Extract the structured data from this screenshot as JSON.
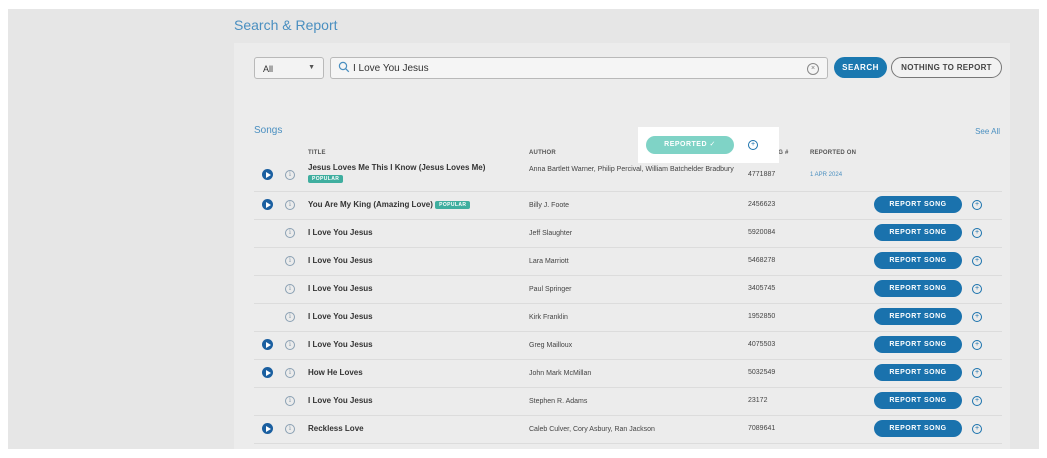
{
  "page": {
    "title": "Search & Report"
  },
  "search": {
    "filter": "All",
    "query": "I Love You Jesus",
    "search_label": "SEARCH",
    "nothing_label": "NOTHING TO REPORT"
  },
  "songs": {
    "section_title": "Songs",
    "see_all": "See All",
    "columns": {
      "title": "TITLE",
      "author": "AUTHOR",
      "ccli": "CCLI SONG #",
      "reported_on": "REPORTED ON"
    },
    "popular_label": "POPULAR",
    "report_label": "REPORT SONG",
    "reported_label": "REPORTED ✓",
    "rows": [
      {
        "title": "Jesus Loves Me This I Know (Jesus Loves Me)",
        "author": "Anna Bartlett Warner, Philip Percival, William Batchelder Bradbury",
        "ccli": "4771887",
        "reported_on": "1 APR 2024"
      },
      {
        "title": "You Are My King (Amazing Love)",
        "author": "Billy J. Foote",
        "ccli": "2456623"
      },
      {
        "title": "I Love You Jesus",
        "author": "Jeff Slaughter",
        "ccli": "5920084"
      },
      {
        "title": "I Love You Jesus",
        "author": "Lara Marriott",
        "ccli": "5468278"
      },
      {
        "title": "I Love You Jesus",
        "author": "Paul Springer",
        "ccli": "3405745"
      },
      {
        "title": "I Love You Jesus",
        "author": "Kirk Franklin",
        "ccli": "1952850"
      },
      {
        "title": "I Love You Jesus",
        "author": "Greg Mailloux",
        "ccli": "4075503"
      },
      {
        "title": "How He Loves",
        "author": "John Mark McMillan",
        "ccli": "5032549"
      },
      {
        "title": "I Love You Jesus",
        "author": "Stephen R. Adams",
        "ccli": "23172"
      },
      {
        "title": "Reckless Love",
        "author": "Caleb Culver, Cory Asbury, Ran Jackson",
        "ccli": "7089641"
      }
    ]
  },
  "colors": {
    "accent": "#1a72ad",
    "popular": "#3fae9f",
    "reported": "#7fd3c6",
    "link": "#4a8fc0"
  }
}
